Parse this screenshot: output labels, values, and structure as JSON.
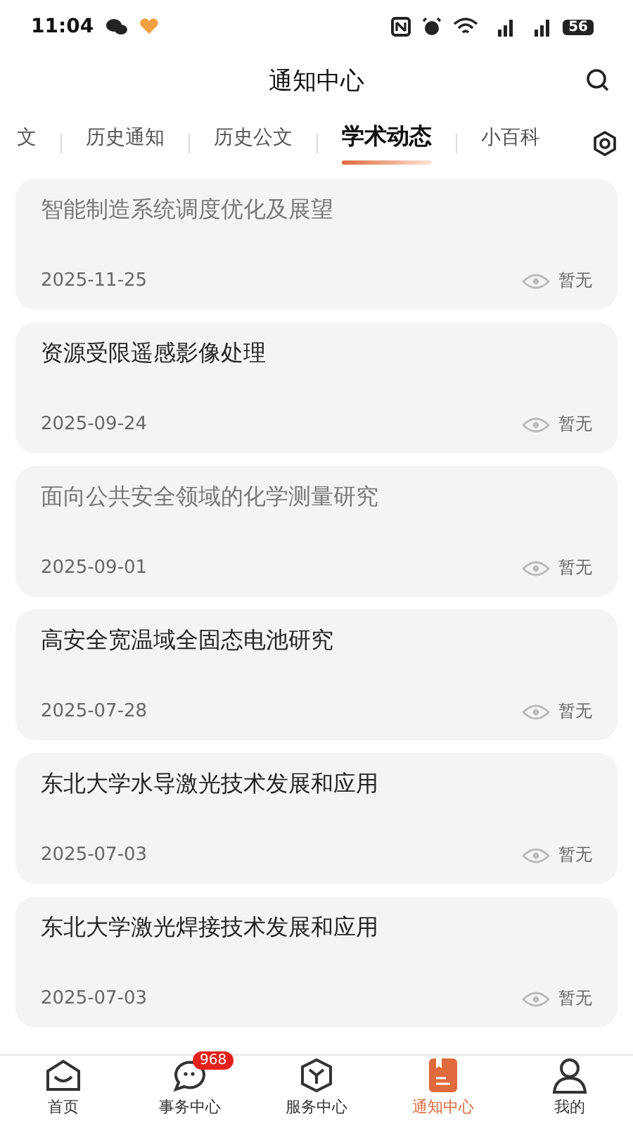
{
  "status_bar": {
    "time": "11:04",
    "battery": "56"
  },
  "header": {
    "title": "通知中心"
  },
  "tabs": [
    {
      "label": "文",
      "selected": false
    },
    {
      "label": "历史通知",
      "selected": false
    },
    {
      "label": "历史公文",
      "selected": false
    },
    {
      "label": "学术动态",
      "selected": true
    },
    {
      "label": "小百科",
      "selected": false
    }
  ],
  "items": [
    {
      "title": "智能制造系统调度优化及展望",
      "date": "2025-11-25",
      "views": "暂无",
      "read": true
    },
    {
      "title": "资源受限遥感影像处理",
      "date": "2025-09-24",
      "views": "暂无",
      "read": false
    },
    {
      "title": "面向公共安全领域的化学测量研究",
      "date": "2025-09-01",
      "views": "暂无",
      "read": true
    },
    {
      "title": "高安全宽温域全固态电池研究",
      "date": "2025-07-28",
      "views": "暂无",
      "read": false
    },
    {
      "title": "东北大学水导激光技术发展和应用",
      "date": "2025-07-03",
      "views": "暂无",
      "read": false
    },
    {
      "title": "东北大学激光焊接技术发展和应用",
      "date": "2025-07-03",
      "views": "暂无",
      "read": false
    }
  ],
  "bottom_nav": [
    {
      "label": "首页",
      "kind": "home",
      "selected": false
    },
    {
      "label": "事务中心",
      "kind": "chat",
      "selected": false,
      "badge": "968"
    },
    {
      "label": "服务中心",
      "kind": "box",
      "selected": false
    },
    {
      "label": "通知中心",
      "kind": "notice",
      "selected": true
    },
    {
      "label": "我的",
      "kind": "user",
      "selected": false
    }
  ]
}
